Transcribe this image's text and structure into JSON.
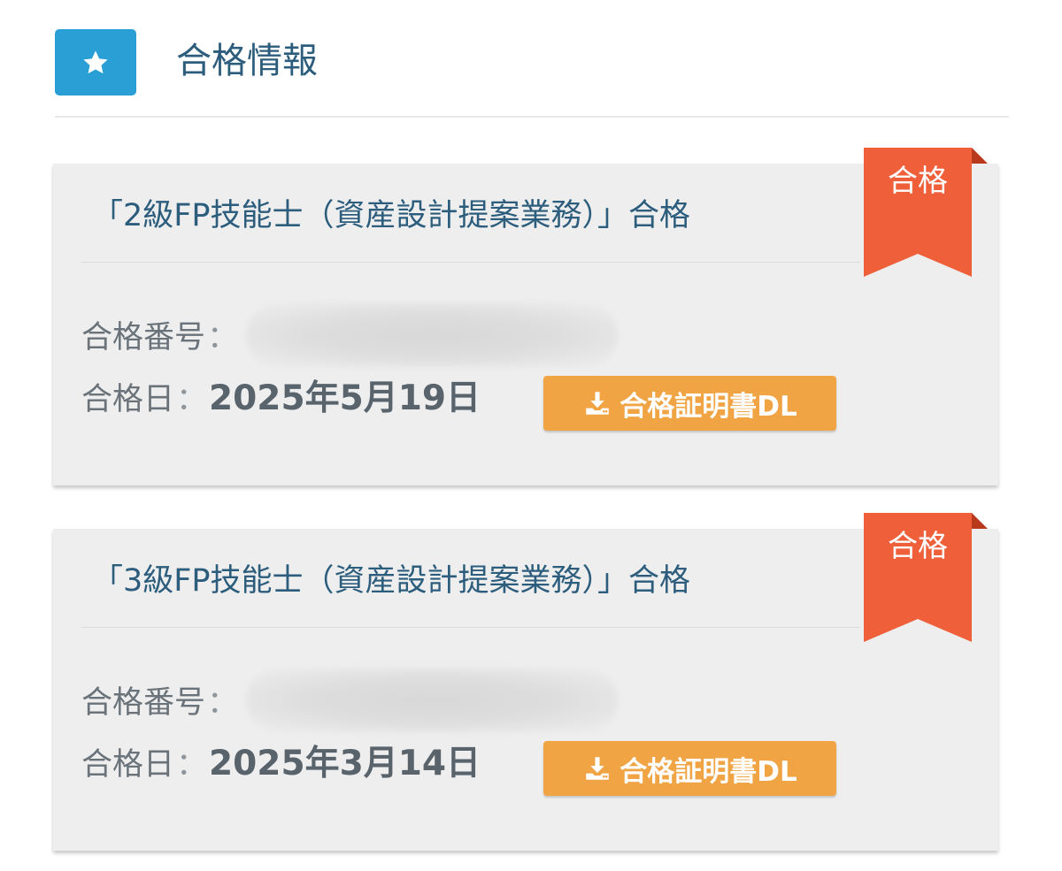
{
  "header": {
    "title": "合格情報",
    "icon": "star-icon",
    "accent_color": "#2a9fd6"
  },
  "cards": [
    {
      "title": "「2級FP技能士（資産設計提案業務）」合格",
      "badge": "合格",
      "number_label": "合格番号",
      "number_sep": "：",
      "date_label": "合格日",
      "date_sep": "：",
      "date_value": "2025年5月19日",
      "download_label": "合格証明書DL",
      "download_icon": "download-icon"
    },
    {
      "title": "「3級FP技能士（資産設計提案業務）」合格",
      "badge": "合格",
      "number_label": "合格番号",
      "number_sep": "：",
      "date_label": "合格日",
      "date_sep": "：",
      "date_value": "2025年3月14日",
      "download_label": "合格証明書DL",
      "download_icon": "download-icon"
    }
  ],
  "colors": {
    "badge": "#ee5f3a",
    "button": "#f0a444",
    "title_text": "#2c5d7d"
  }
}
